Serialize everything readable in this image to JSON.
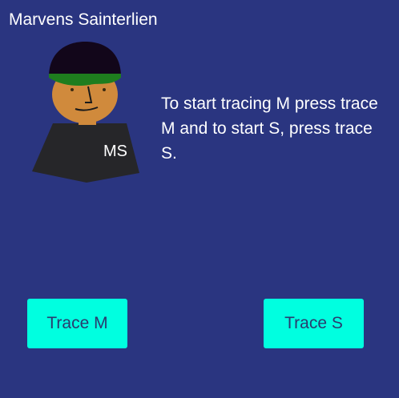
{
  "header": {
    "title": "Marvens Sainterlien"
  },
  "avatar": {
    "initials": "MS",
    "colors": {
      "cap": "#12061a",
      "cap_brim": "#1e7d1e",
      "skin": "#d08a3c",
      "shirt": "#262629"
    }
  },
  "main": {
    "instructions": "To start tracing M press trace M and to start S, press trace S."
  },
  "buttons": {
    "trace_m_label": "Trace M",
    "trace_s_label": "Trace S"
  },
  "theme": {
    "background": "#2a3580",
    "button_bg": "#00ffe0",
    "button_text": "#2b3a6e",
    "text": "#ffffff"
  }
}
